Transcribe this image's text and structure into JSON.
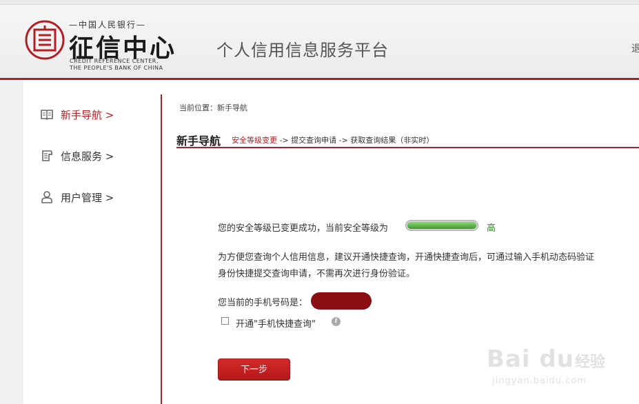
{
  "header": {
    "logo_top": "—中国人民银行—",
    "logo_main": "征信中心",
    "logo_en_line1": "CREDIT REFERENCE CENTER,",
    "logo_en_line2": "THE PEOPLE'S BANK OF CHINA",
    "platform_title": "个人信用信息服务平台",
    "exit_text": "退"
  },
  "sidebar": {
    "items": [
      {
        "label": "新手导航 >",
        "icon": "book-icon",
        "active": true
      },
      {
        "label": "信息服务 >",
        "icon": "document-icon",
        "active": false
      },
      {
        "label": "用户管理 >",
        "icon": "user-icon",
        "active": false
      }
    ]
  },
  "main": {
    "breadcrumb": "当前位置：新手导航",
    "title": "新手导航",
    "steps": {
      "current": "安全等级变更",
      "rest": " -> 提交查询申请 -> 获取查询结果（非实时）"
    },
    "security_message": "您的安全等级已变更成功，当前安全等级为",
    "security_level_fraction": 1.0,
    "security_level_text": "高",
    "advice_line1": "为方便您查询个人信用信息，建议开通快捷查询，开通快捷查询后，可通过输入手机动态码验证",
    "advice_line2": "身份快捷提交查询申请，不需再次进行身份验证。",
    "phone_label": "您当前的手机号码是：",
    "checkbox_label": "开通\"手机快捷查询\"",
    "checkbox_checked": false,
    "info_icon_glyph": "i",
    "next_button": "下一步"
  },
  "watermark": {
    "brand": "Bai du",
    "cn": "经验",
    "url": "jingyan.baidu.com"
  },
  "colors": {
    "brand_red": "#b01f24",
    "level_green": "#3e9a2b",
    "masked_phone": "#8a0d12"
  }
}
